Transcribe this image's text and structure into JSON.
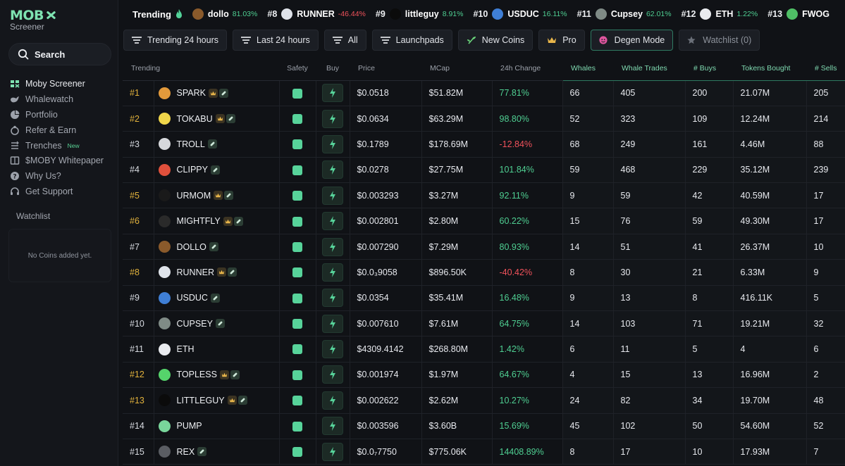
{
  "brand": {
    "logo_text": "MOB",
    "subtitle": "Screener"
  },
  "sidebar": {
    "search_label": "Search",
    "items": [
      {
        "label": "Moby Screener",
        "icon": "moby-logo-icon",
        "active": true
      },
      {
        "label": "Whalewatch",
        "icon": "whale-icon"
      },
      {
        "label": "Portfolio",
        "icon": "pie-chart-icon"
      },
      {
        "label": "Refer & Earn",
        "icon": "gift-icon"
      },
      {
        "label": "Trenches",
        "icon": "trenches-icon",
        "badge": "New"
      },
      {
        "label": "$MOBY Whitepaper",
        "icon": "book-icon"
      },
      {
        "label": "Why Us?",
        "icon": "question-icon"
      },
      {
        "label": "Get Support",
        "icon": "headset-icon"
      }
    ],
    "watchlist_title": "Watchlist",
    "watchlist_empty": "No Coins added yet."
  },
  "trending_bar": {
    "title": "Trending",
    "items": [
      {
        "rank": "",
        "name": "dollo",
        "pct": "81.03%",
        "dir": "pos",
        "color": "#8a5a2b"
      },
      {
        "rank": "#8",
        "name": "RUNNER",
        "pct": "-46.44%",
        "dir": "neg",
        "color": "#dfe3ea"
      },
      {
        "rank": "#9",
        "name": "littleguy",
        "pct": "8.91%",
        "dir": "pos",
        "color": "#0b0b0b"
      },
      {
        "rank": "#10",
        "name": "USDUC",
        "pct": "16.11%",
        "dir": "pos",
        "color": "#3f7fd6"
      },
      {
        "rank": "#11",
        "name": "Cupsey",
        "pct": "62.01%",
        "dir": "pos",
        "color": "#7f8b86"
      },
      {
        "rank": "#12",
        "name": "ETH",
        "pct": "1.22%",
        "dir": "pos",
        "color": "#e9ebef"
      },
      {
        "rank": "#13",
        "name": "FWOG",
        "pct": "",
        "dir": "pos",
        "color": "#4fbf66"
      }
    ]
  },
  "filters": [
    {
      "label": "Trending 24 hours",
      "icon": "filter-lines-icon"
    },
    {
      "label": "Last 24 hours",
      "icon": "filter-lines-icon"
    },
    {
      "label": "All",
      "icon": "filter-lines-icon"
    },
    {
      "label": "Launchpads",
      "icon": "filter-lines-icon"
    },
    {
      "label": "New Coins",
      "icon": "sprout-icon"
    },
    {
      "label": "Pro",
      "icon": "crown-icon"
    },
    {
      "label": "Degen Mode",
      "icon": "degen-icon"
    },
    {
      "label": "Watchlist (0)",
      "icon": "star-icon"
    }
  ],
  "table": {
    "headers": [
      "Trending",
      "Safety",
      "Buy",
      "Price",
      "MCap",
      "24h Change",
      "Whales",
      "Whale Trades",
      "# Buys",
      "Tokens Bought",
      "# Sells"
    ],
    "rows": [
      {
        "rank": "#1",
        "gold": true,
        "name": "SPARK",
        "crown": true,
        "pill": true,
        "price": "$0.0518",
        "mcap": "$51.82M",
        "change": "77.81%",
        "dir": "pos",
        "whales": "66",
        "trades": "405",
        "buys": "200",
        "bought": "21.07M",
        "sells": "205",
        "color": "#e39a3b"
      },
      {
        "rank": "#2",
        "gold": true,
        "name": "TOKABU",
        "crown": true,
        "pill": true,
        "price": "$0.0634",
        "mcap": "$63.29M",
        "change": "98.80%",
        "dir": "pos",
        "whales": "52",
        "trades": "323",
        "buys": "109",
        "bought": "12.24M",
        "sells": "214",
        "color": "#f0d64a"
      },
      {
        "rank": "#3",
        "gold": false,
        "name": "TROLL",
        "crown": false,
        "pill": true,
        "price": "$0.1789",
        "mcap": "$178.69M",
        "change": "-12.84%",
        "dir": "neg",
        "whales": "68",
        "trades": "249",
        "buys": "161",
        "bought": "4.46M",
        "sells": "88",
        "color": "#d6d8dc"
      },
      {
        "rank": "#4",
        "gold": false,
        "name": "CLIPPY",
        "crown": false,
        "pill": true,
        "price": "$0.0278",
        "mcap": "$27.75M",
        "change": "101.84%",
        "dir": "pos",
        "whales": "59",
        "trades": "468",
        "buys": "229",
        "bought": "35.12M",
        "sells": "239",
        "color": "#e0503c"
      },
      {
        "rank": "#5",
        "gold": true,
        "name": "URMOM",
        "crown": true,
        "pill": true,
        "price": "$0.003293",
        "mcap": "$3.27M",
        "change": "92.11%",
        "dir": "pos",
        "whales": "9",
        "trades": "59",
        "buys": "42",
        "bought": "40.59M",
        "sells": "17",
        "color": "#1a1a1a"
      },
      {
        "rank": "#6",
        "gold": true,
        "name": "MIGHTFLY",
        "crown": true,
        "pill": true,
        "price": "$0.002801",
        "mcap": "$2.80M",
        "change": "60.22%",
        "dir": "pos",
        "whales": "15",
        "trades": "76",
        "buys": "59",
        "bought": "49.30M",
        "sells": "17",
        "color": "#2a2a2a"
      },
      {
        "rank": "#7",
        "gold": false,
        "name": "DOLLO",
        "crown": false,
        "pill": true,
        "price": "$0.007290",
        "mcap": "$7.29M",
        "change": "80.93%",
        "dir": "pos",
        "whales": "14",
        "trades": "51",
        "buys": "41",
        "bought": "26.37M",
        "sells": "10",
        "color": "#8a5a2b"
      },
      {
        "rank": "#8",
        "gold": true,
        "name": "RUNNER",
        "crown": true,
        "pill": true,
        "price": "$0.0₃9058",
        "mcap": "$896.50K",
        "change": "-40.42%",
        "dir": "neg",
        "whales": "8",
        "trades": "30",
        "buys": "21",
        "bought": "6.33M",
        "sells": "9",
        "color": "#dfe3ea"
      },
      {
        "rank": "#9",
        "gold": false,
        "name": "USDUC",
        "crown": false,
        "pill": true,
        "price": "$0.0354",
        "mcap": "$35.41M",
        "change": "16.48%",
        "dir": "pos",
        "whales": "9",
        "trades": "13",
        "buys": "8",
        "bought": "416.11K",
        "sells": "5",
        "color": "#3f7fd6"
      },
      {
        "rank": "#10",
        "gold": false,
        "name": "CUPSEY",
        "crown": false,
        "pill": true,
        "price": "$0.007610",
        "mcap": "$7.61M",
        "change": "64.75%",
        "dir": "pos",
        "whales": "14",
        "trades": "103",
        "buys": "71",
        "bought": "19.21M",
        "sells": "32",
        "color": "#7f8b86"
      },
      {
        "rank": "#11",
        "gold": false,
        "name": "ETH",
        "crown": false,
        "pill": false,
        "price": "$4309.4142",
        "mcap": "$268.80M",
        "change": "1.42%",
        "dir": "pos",
        "whales": "6",
        "trades": "11",
        "buys": "5",
        "bought": "4",
        "sells": "6",
        "color": "#e9ebef"
      },
      {
        "rank": "#12",
        "gold": true,
        "name": "TOPLESS",
        "crown": true,
        "pill": true,
        "price": "$0.001974",
        "mcap": "$1.97M",
        "change": "64.67%",
        "dir": "pos",
        "whales": "4",
        "trades": "15",
        "buys": "13",
        "bought": "16.96M",
        "sells": "2",
        "color": "#55d46b"
      },
      {
        "rank": "#13",
        "gold": true,
        "name": "LITTLEGUY",
        "crown": true,
        "pill": true,
        "price": "$0.002622",
        "mcap": "$2.62M",
        "change": "10.27%",
        "dir": "pos",
        "whales": "24",
        "trades": "82",
        "buys": "34",
        "bought": "19.70M",
        "sells": "48",
        "color": "#0b0b0b"
      },
      {
        "rank": "#14",
        "gold": false,
        "name": "PUMP",
        "crown": false,
        "pill": false,
        "price": "$0.003596",
        "mcap": "$3.60B",
        "change": "15.69%",
        "dir": "pos",
        "whales": "45",
        "trades": "102",
        "buys": "50",
        "bought": "54.60M",
        "sells": "52",
        "color": "#79d69b"
      },
      {
        "rank": "#15",
        "gold": false,
        "name": "REX",
        "crown": false,
        "pill": true,
        "price": "$0.0₇7750",
        "mcap": "$775.06K",
        "change": "14408.89%",
        "dir": "pos",
        "whales": "8",
        "trades": "17",
        "buys": "10",
        "bought": "17.93M",
        "sells": "7",
        "color": "#5a5d63"
      }
    ]
  }
}
